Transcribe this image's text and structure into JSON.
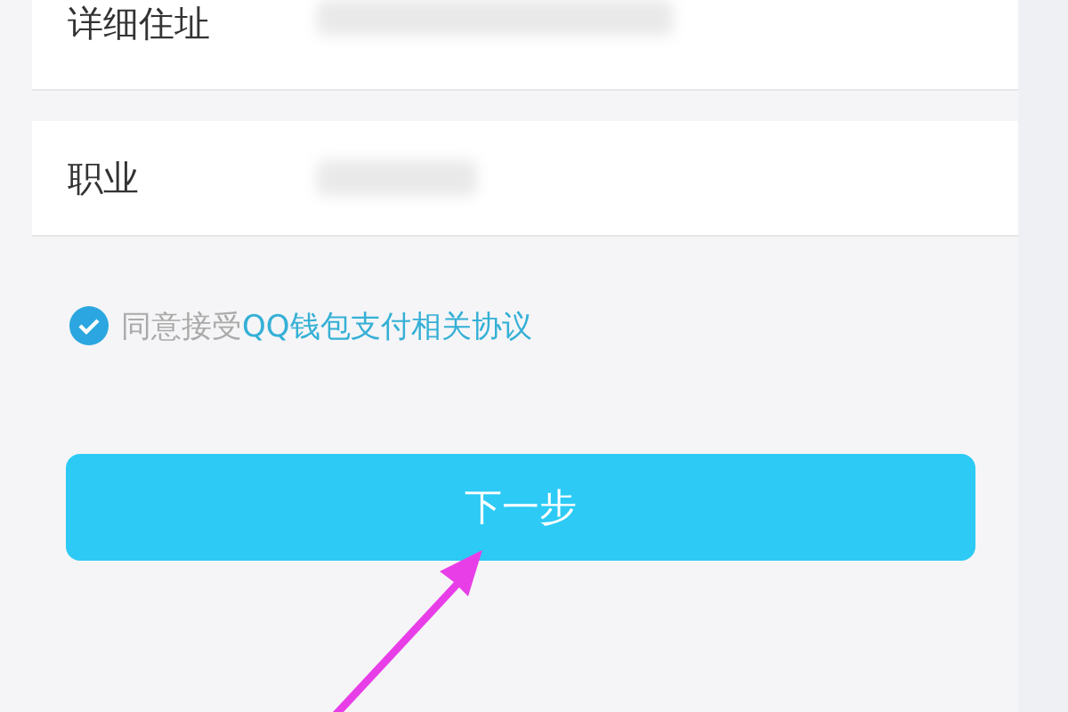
{
  "fields": [
    {
      "label": "详细住址"
    },
    {
      "label": "职业"
    }
  ],
  "agreement": {
    "checked": true,
    "prefix": "同意接受",
    "link": "QQ钱包支付相关协议"
  },
  "next_button": {
    "label": "下一步"
  }
}
